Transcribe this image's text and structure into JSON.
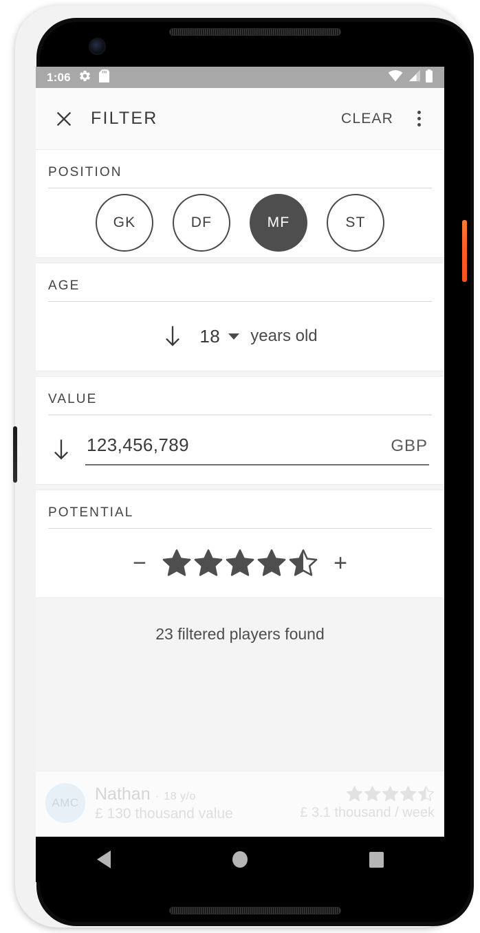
{
  "status_bar": {
    "time": "1:06",
    "icons_left": [
      "gear-icon",
      "sd-card-icon"
    ],
    "icons_right": [
      "wifi-icon",
      "cell-signal-icon",
      "battery-icon"
    ]
  },
  "app_bar": {
    "close_icon": "close-icon",
    "title": "FILTER",
    "clear_label": "CLEAR",
    "overflow_icon": "overflow-menu-icon"
  },
  "sections": {
    "position": {
      "label": "POSITION",
      "options": [
        {
          "code": "GK",
          "selected": false
        },
        {
          "code": "DF",
          "selected": false
        },
        {
          "code": "MF",
          "selected": true
        },
        {
          "code": "ST",
          "selected": false
        }
      ]
    },
    "age": {
      "label": "AGE",
      "direction_icon": "arrow-down-icon",
      "value": "18",
      "caret_icon": "chevron-down-icon",
      "unit": "years old"
    },
    "value": {
      "label": "VALUE",
      "direction_icon": "arrow-down-icon",
      "amount": "123,456,789",
      "placeholder": "0",
      "currency": "GBP"
    },
    "potential": {
      "label": "POTENTIAL",
      "minus_label": "−",
      "plus_label": "+",
      "rating": 4.5,
      "max_stars": 5
    }
  },
  "result": {
    "text": "23 filtered players found"
  },
  "player_card": {
    "avatar_initials": "AMC",
    "name": "Nathan",
    "separator": "·",
    "age": "18 y/o",
    "value": "£ 130 thousand value",
    "rating": 4.5,
    "max_stars": 5,
    "wage": "£ 3.1 thousand / week"
  },
  "nav_bar": {
    "back_icon": "nav-back-icon",
    "home_icon": "nav-home-icon",
    "recents_icon": "nav-recents-icon"
  },
  "colors": {
    "selected_chip": "#4e4e4e",
    "status_bar": "#a8a8a8",
    "power_button": "#ff5e22",
    "text_primary": "#3a3a3a"
  }
}
